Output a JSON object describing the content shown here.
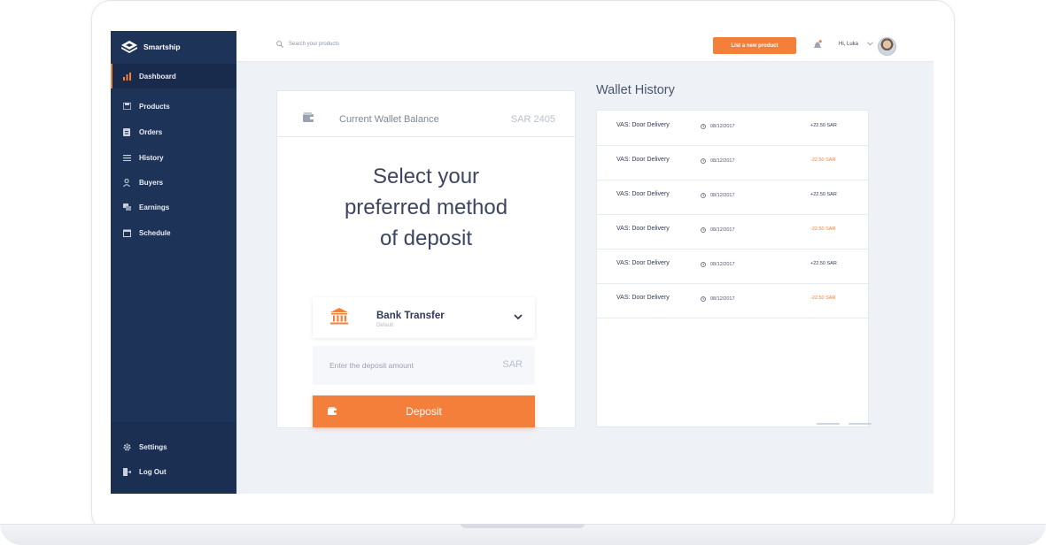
{
  "app": {
    "brand": "Smartship"
  },
  "sidebar": {
    "items": [
      {
        "label": "Dashboard",
        "icon": "bar-chart-icon",
        "active": true
      },
      {
        "label": "Products",
        "icon": "products-icon"
      },
      {
        "label": "Orders",
        "icon": "orders-icon"
      },
      {
        "label": "History",
        "icon": "history-list-icon"
      },
      {
        "label": "Buyers",
        "icon": "user-icon"
      },
      {
        "label": "Earnings",
        "icon": "earnings-icon"
      },
      {
        "label": "Schedule",
        "icon": "calendar-icon"
      }
    ],
    "bottom": [
      {
        "label": "Settings",
        "icon": "gear-icon"
      },
      {
        "label": "Log Out",
        "icon": "logout-icon"
      }
    ]
  },
  "header": {
    "search_placeholder": "Search your products",
    "list_button": "List a new product",
    "greeting": "Hi, Luka"
  },
  "deposit": {
    "balance_label": "Current Wallet Balance",
    "balance_value": "SAR 2405",
    "headline": [
      "Select your",
      "preferred method",
      "of deposit"
    ],
    "method_title": "Bank Transfer",
    "method_sub": "Default",
    "amount_placeholder": "Enter the deposit amount",
    "currency": "SAR",
    "button": "Deposit"
  },
  "wallet_history": {
    "title": "Wallet History",
    "rows": [
      {
        "desc": "VAS: Door Delivery",
        "date": "08/12/2017",
        "amount": "+22.50 SAR",
        "type": "pos"
      },
      {
        "desc": "VAS: Door Delivery",
        "date": "08/12/2017",
        "amount": "-22.50 SAR",
        "type": "neg"
      },
      {
        "desc": "VAS: Door Delivery",
        "date": "08/12/2017",
        "amount": "+22.50 SAR",
        "type": "pos"
      },
      {
        "desc": "VAS: Door Delivery",
        "date": "08/12/2017",
        "amount": "-22.50 SAR",
        "type": "neg"
      },
      {
        "desc": "VAS: Door Delivery",
        "date": "08/12/2017",
        "amount": "+22.50 SAR",
        "type": "pos"
      },
      {
        "desc": "VAS: Door Delivery",
        "date": "08/12/2017",
        "amount": "-22.50 SAR",
        "type": "neg"
      }
    ]
  },
  "colors": {
    "accent": "#f47f3a",
    "sidebar": "#1e3358",
    "background": "#eef1f6"
  }
}
